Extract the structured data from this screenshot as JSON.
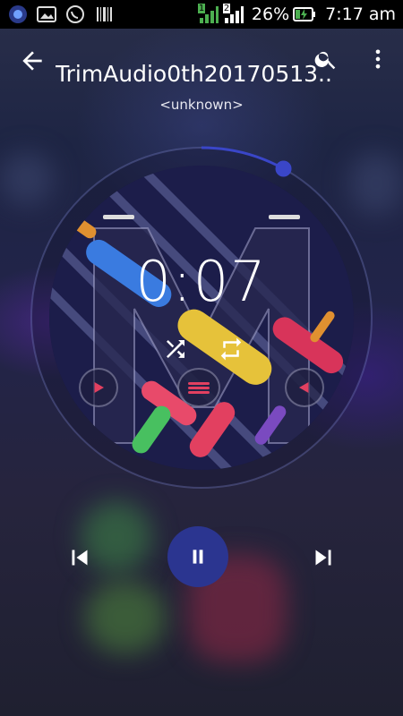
{
  "status_bar": {
    "battery_percent": "26%",
    "time": "7:17 am",
    "signal_1_label": "1",
    "signal_2_label": "2"
  },
  "track": {
    "title": "TrimAudio0th20170513..",
    "artist": "<unknown>",
    "elapsed": "0:07"
  },
  "progress": {
    "fraction": 0.05
  },
  "colors": {
    "accent": "#2b3590",
    "seek_knob": "#3a46c8",
    "status_green": "#4caf50"
  },
  "icons": {
    "back": "arrow-left",
    "search": "magnifier",
    "more": "vertical-ellipsis",
    "shuffle": "shuffle",
    "repeat": "repeat",
    "previous": "skip-previous",
    "pause": "pause",
    "next": "skip-next",
    "equalizer": "equalizer",
    "prev_small": "play-left",
    "next_small": "play-right"
  }
}
